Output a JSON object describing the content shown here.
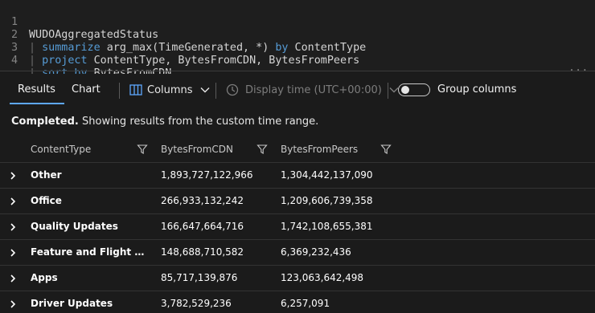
{
  "editor": {
    "lines": [
      {
        "num": "1",
        "text": "WUDOAggregatedStatus"
      },
      {
        "num": "2",
        "pipe": "| ",
        "keyword": "summarize",
        "rest": " arg_max(TimeGenerated, *) ",
        "keyword2": "by",
        "rest2": " ContentType"
      },
      {
        "num": "3",
        "pipe": "| ",
        "keyword": "project",
        "rest": " ContentType, BytesFromCDN, BytesFromPeers"
      },
      {
        "num": "4",
        "pipe": "| ",
        "keyword": "sort by",
        "rest": " BytesFromCDN"
      }
    ],
    "splitter_handle": "..."
  },
  "toolbar": {
    "tabs": [
      {
        "label": "Results",
        "active": true
      },
      {
        "label": "Chart",
        "active": false
      }
    ],
    "columns_label": "Columns",
    "display_time_label": "Display time (UTC+00:00)",
    "group_columns_label": "Group columns",
    "group_columns_on": false
  },
  "status": {
    "bold": "Completed.",
    "text": " Showing results from the custom time range."
  },
  "grid": {
    "columns": [
      "ContentType",
      "BytesFromCDN",
      "BytesFromPeers"
    ],
    "rows": [
      {
        "ContentType": "Other",
        "BytesFromCDN": "1,893,727,122,966",
        "BytesFromPeers": "1,304,442,137,090"
      },
      {
        "ContentType": "Office",
        "BytesFromCDN": "266,933,132,242",
        "BytesFromPeers": "1,209,606,739,358"
      },
      {
        "ContentType": "Quality Updates",
        "BytesFromCDN": "166,647,664,716",
        "BytesFromPeers": "1,742,108,655,381"
      },
      {
        "ContentType": "Feature and Flight Upd...",
        "BytesFromCDN": "148,688,710,582",
        "BytesFromPeers": "6,369,232,436"
      },
      {
        "ContentType": "Apps",
        "BytesFromCDN": "85,717,139,876",
        "BytesFromPeers": "123,063,642,498"
      },
      {
        "ContentType": "Driver Updates",
        "BytesFromCDN": "3,782,529,236",
        "BytesFromPeers": "6,257,091"
      }
    ]
  },
  "colors": {
    "accent": "#5ea8ff",
    "keyword": "#569cd6",
    "background": "#1b1b1b"
  },
  "icons": [
    "columns-icon",
    "chevron-down-icon",
    "clock-icon",
    "filter-icon",
    "chevron-right-icon"
  ]
}
